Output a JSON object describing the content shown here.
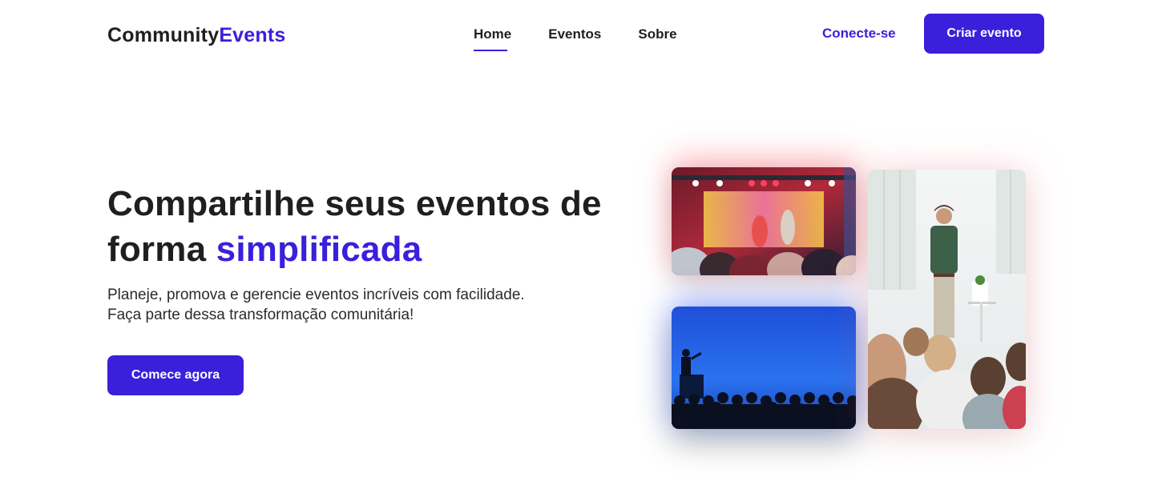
{
  "header": {
    "logo_base": "Community",
    "logo_accent": "Events",
    "nav": [
      {
        "label": "Home",
        "active": true
      },
      {
        "label": "Eventos",
        "active": false
      },
      {
        "label": "Sobre",
        "active": false
      }
    ],
    "login_label": "Conecte-se",
    "create_label": "Criar evento"
  },
  "hero": {
    "title_line1": "Compartilhe seus eventos de",
    "title_line2_prefix": "forma ",
    "title_highlight": "simplificada",
    "subtitle_line1": "Planeje, promova e gerencie eventos incríveis com facilidade.",
    "subtitle_line2": "Faça parte dessa transformação comunitária!",
    "cta_label": "Comece agora"
  },
  "images": [
    {
      "name": "concert-photo",
      "alt": "concert stage"
    },
    {
      "name": "auditorium-photo",
      "alt": "speaker in blue auditorium"
    },
    {
      "name": "speaker-photo",
      "alt": "speaker presenting to audience"
    }
  ],
  "colors": {
    "accent": "#3a1fdb",
    "text": "#1f1f1f",
    "background": "#ffffff"
  }
}
